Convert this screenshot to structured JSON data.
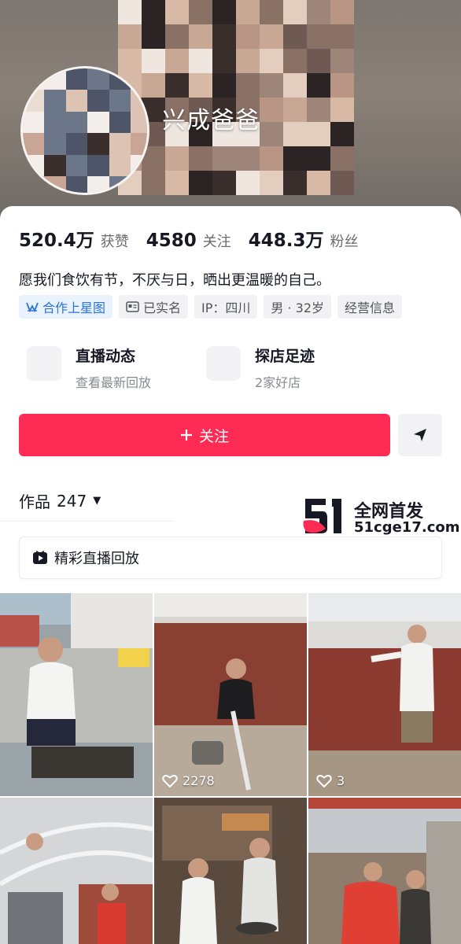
{
  "profile": {
    "nickname": "兴成爸爸",
    "bio": "愿我们食饮有节，不厌与日，晒出更温暖的自己。"
  },
  "stats": [
    {
      "value": "520.4万",
      "label": "获赞"
    },
    {
      "value": "4580",
      "label": "关注"
    },
    {
      "value": "448.3万",
      "label": "粉丝"
    }
  ],
  "tags": [
    {
      "label": "合作上星图",
      "icon": "star-map-icon"
    },
    {
      "label": "已实名",
      "icon": "id-card-icon"
    },
    {
      "label": "IP：四川",
      "icon": ""
    },
    {
      "label": "男 · 32岁",
      "icon": ""
    },
    {
      "label": "经营信息",
      "icon": ""
    }
  ],
  "features": [
    {
      "title": "直播动态",
      "subtitle": "查看最新回放"
    },
    {
      "title": "探店足迹",
      "subtitle": "2家好店"
    }
  ],
  "actions": {
    "follow_label": "关注",
    "follow_icon": "plus-icon",
    "message_icon": "send-icon"
  },
  "works": {
    "label": "作品",
    "count": "247"
  },
  "live_replay": {
    "label": "精彩直播回放",
    "icon": "play-icon"
  },
  "watermark": {
    "line1": "全网首发",
    "line2": "51cge17.com"
  },
  "videos": [
    {
      "likes": ""
    },
    {
      "likes": "2278"
    },
    {
      "likes": "3"
    },
    {
      "likes": ""
    },
    {
      "likes": ""
    },
    {
      "likes": ""
    }
  ],
  "colors": {
    "accent": "#fe2c55",
    "tag_blue": "#2a74d8"
  }
}
